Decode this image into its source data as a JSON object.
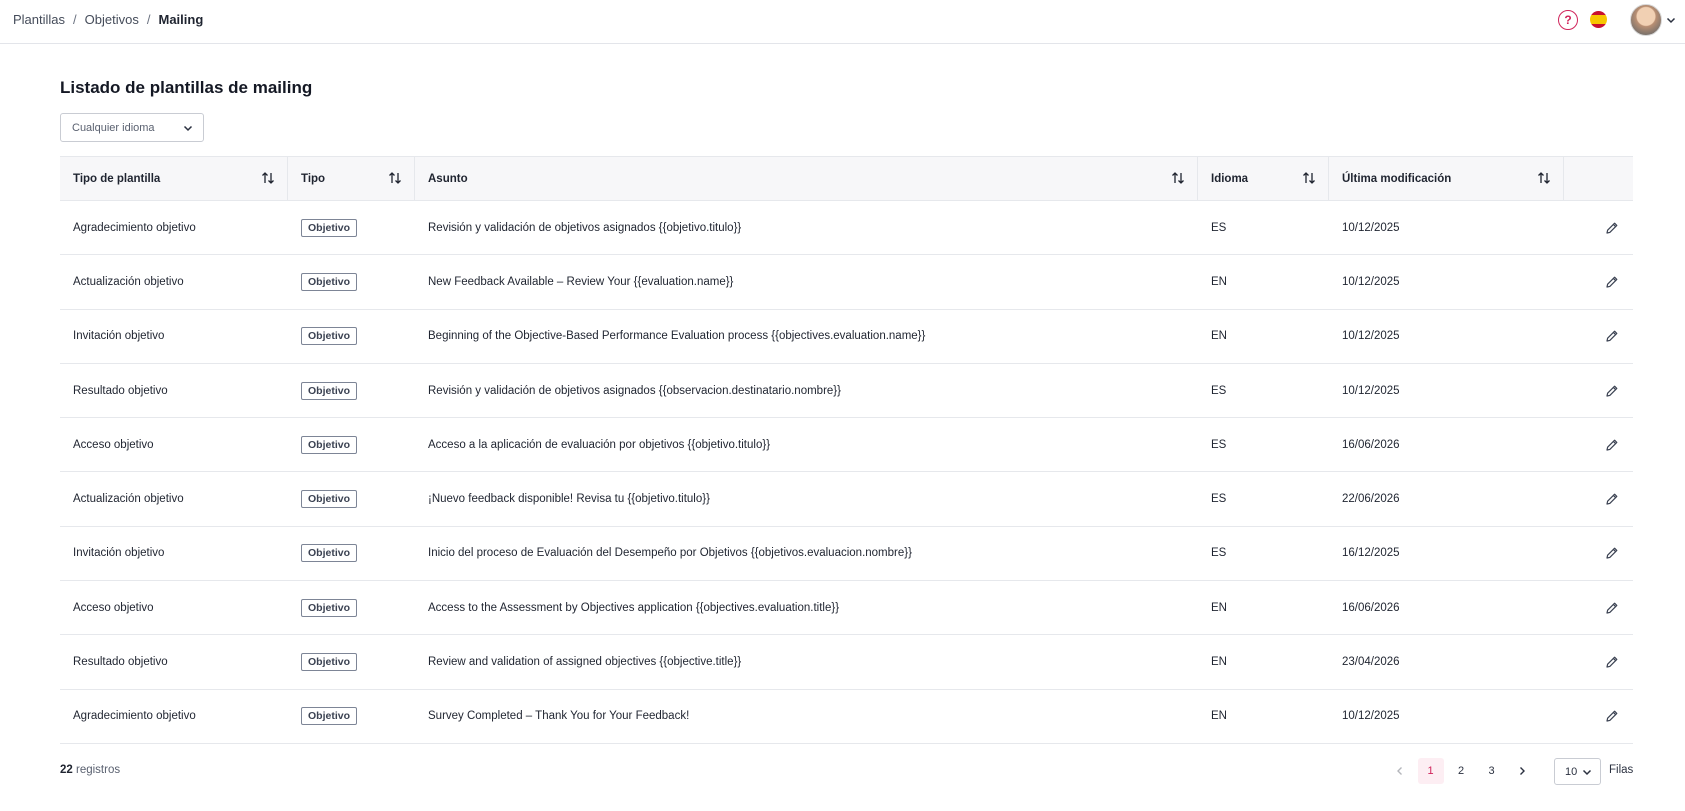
{
  "breadcrumb": {
    "items": [
      "Plantillas",
      "Objetivos"
    ],
    "current": "Mailing",
    "separator": "/"
  },
  "header": {
    "help_icon": "?",
    "flag": "spain-flag-icon"
  },
  "page": {
    "title": "Listado de plantillas de mailing"
  },
  "filter": {
    "language_select_value": "Cualquier idioma"
  },
  "table": {
    "columns": [
      "Tipo de plantilla",
      "Tipo",
      "Asunto",
      "Idioma",
      "Última modificación",
      ""
    ],
    "rows": [
      {
        "tipo_plantilla": "Agradecimiento objetivo",
        "tipo": "Objetivo",
        "asunto": "Revisión y validación de objetivos asignados {{objetivo.titulo}}",
        "idioma": "ES",
        "fecha": "10/12/2025"
      },
      {
        "tipo_plantilla": "Actualización objetivo",
        "tipo": "Objetivo",
        "asunto": "New Feedback Available – Review Your {{evaluation.name}}",
        "idioma": "EN",
        "fecha": "10/12/2025"
      },
      {
        "tipo_plantilla": "Invitación objetivo",
        "tipo": "Objetivo",
        "asunto": "Beginning of the Objective-Based Performance Evaluation process {{objectives.evaluation.name}}",
        "idioma": "EN",
        "fecha": "10/12/2025"
      },
      {
        "tipo_plantilla": "Resultado objetivo",
        "tipo": "Objetivo",
        "asunto": "Revisión y validación de objetivos asignados {{observacion.destinatario.nombre}}",
        "idioma": "ES",
        "fecha": "10/12/2025"
      },
      {
        "tipo_plantilla": "Acceso objetivo",
        "tipo": "Objetivo",
        "asunto": "Acceso a la aplicación de evaluación por objetivos {{objetivo.titulo}}",
        "idioma": "ES",
        "fecha": "16/06/2026"
      },
      {
        "tipo_plantilla": "Actualización objetivo",
        "tipo": "Objetivo",
        "asunto": "¡Nuevo feedback disponible! Revisa tu {{objetivo.titulo}}",
        "idioma": "ES",
        "fecha": "22/06/2026"
      },
      {
        "tipo_plantilla": "Invitación objetivo",
        "tipo": "Objetivo",
        "asunto": "Inicio del proceso de Evaluación del Desempeño por Objetivos {{objetivos.evaluacion.nombre}}",
        "idioma": "ES",
        "fecha": "16/12/2025"
      },
      {
        "tipo_plantilla": "Acceso objetivo",
        "tipo": "Objetivo",
        "asunto": "Access to the Assessment by Objectives application {{objectives.evaluation.title}}",
        "idioma": "EN",
        "fecha": "16/06/2026"
      },
      {
        "tipo_plantilla": "Resultado objetivo",
        "tipo": "Objetivo",
        "asunto": "Review and validation of assigned objectives {{objective.title}}",
        "idioma": "EN",
        "fecha": "23/04/2026"
      },
      {
        "tipo_plantilla": "Agradecimiento objetivo",
        "tipo": "Objetivo",
        "asunto": "Survey Completed – Thank You for Your Feedback!",
        "idioma": "EN",
        "fecha": "10/12/2025"
      }
    ]
  },
  "footer": {
    "count": "22",
    "count_label": "registros",
    "pages": [
      "1",
      "2",
      "3"
    ],
    "current_page": "1",
    "rows_per_page": "10",
    "rows_label": "Filas"
  },
  "colors": {
    "accent": "#d0245b",
    "border": "#e6e8ec",
    "header_bg": "#f7f7f9"
  }
}
